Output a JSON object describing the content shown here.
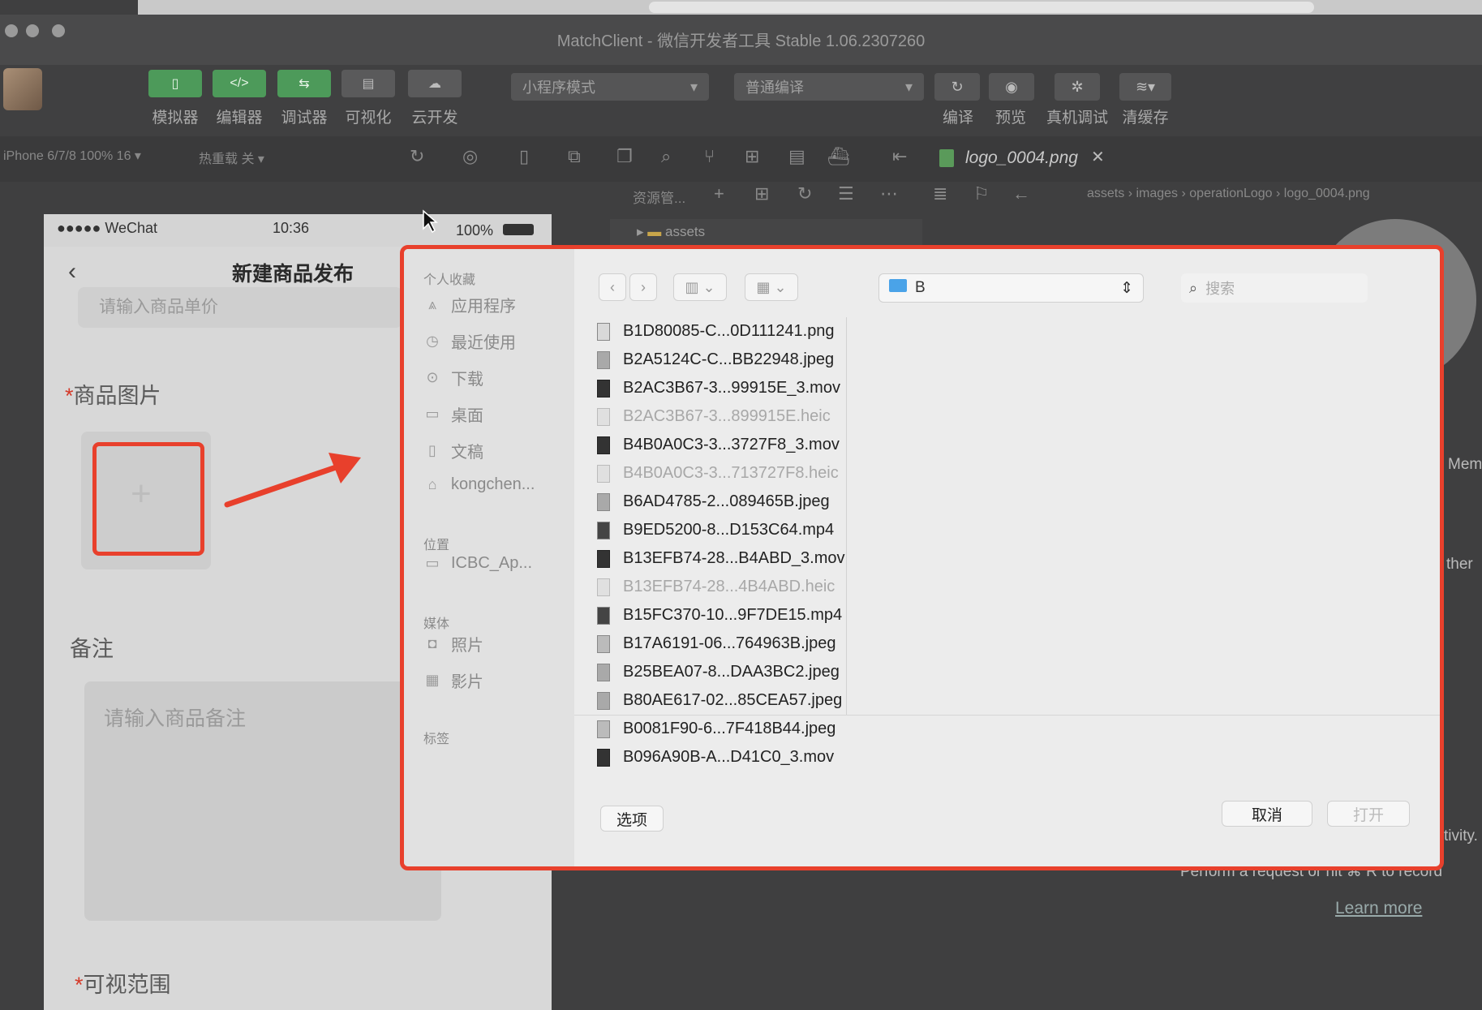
{
  "window": {
    "title": "MatchClient - 微信开发者工具 Stable 1.06.2307260"
  },
  "toolbar": {
    "buttons": [
      {
        "label": "模拟器",
        "icon": "phone-icon"
      },
      {
        "label": "编辑器",
        "icon": "code-icon"
      },
      {
        "label": "调试器",
        "icon": "debug-icon"
      },
      {
        "label": "可视化",
        "icon": "layout-icon"
      },
      {
        "label": "云开发",
        "icon": "cloud-icon"
      }
    ],
    "mode_select": "小程序模式",
    "compile_select": "普通编译",
    "actions": [
      "编译",
      "预览",
      "真机调试",
      "清缓存"
    ]
  },
  "subbar": {
    "device": "iPhone 6/7/8 100% 16 ▾",
    "hotreload": "热重载 关 ▾",
    "explorer_label": "资源管...",
    "tab_file": "logo_0004.png",
    "breadcrumb": [
      "assets",
      "images",
      "operationLogo",
      "logo_0004.png"
    ],
    "tree_folder": "assets"
  },
  "phone": {
    "status": {
      "carrier": "●●●●● WeChat",
      "time": "10:36",
      "battery": "100%"
    },
    "page_title": "新建商品发布",
    "price_placeholder": "请输入商品单价",
    "image_label": "商品图片",
    "remark_label": "备注",
    "remark_placeholder": "请输入商品备注",
    "visibility_label": "可视范围",
    "required_mark": "*",
    "add_symbol": "+"
  },
  "dialog": {
    "sidebar": {
      "favorites_title": "个人收藏",
      "favorites": [
        {
          "label": "应用程序",
          "icon": "apps-icon"
        },
        {
          "label": "最近使用",
          "icon": "clock-icon"
        },
        {
          "label": "下载",
          "icon": "download-icon"
        },
        {
          "label": "桌面",
          "icon": "desktop-icon"
        },
        {
          "label": "文稿",
          "icon": "document-icon"
        },
        {
          "label": "kongchen...",
          "icon": "home-icon"
        }
      ],
      "locations_title": "位置",
      "locations": [
        {
          "label": "ICBC_Ap...",
          "icon": "disk-icon"
        }
      ],
      "media_title": "媒体",
      "media": [
        {
          "label": "照片",
          "icon": "camera-icon"
        },
        {
          "label": "影片",
          "icon": "film-icon"
        }
      ],
      "tags_title": "标签"
    },
    "path_folder": "B",
    "search_placeholder": "搜索",
    "files": [
      {
        "name": "B1D80085-C...0D111241.png",
        "type": "png",
        "dim": false
      },
      {
        "name": "B2A5124C-C...BB22948.jpeg",
        "type": "jpeg",
        "dim": false
      },
      {
        "name": "B2AC3B67-3...99915E_3.mov",
        "type": "mov",
        "dim": false
      },
      {
        "name": "B2AC3B67-3...899915E.heic",
        "type": "heic",
        "dim": true
      },
      {
        "name": "B4B0A0C3-3...3727F8_3.mov",
        "type": "mov",
        "dim": false
      },
      {
        "name": "B4B0A0C3-3...713727F8.heic",
        "type": "heic",
        "dim": true
      },
      {
        "name": "B6AD4785-2...089465B.jpeg",
        "type": "jpeg",
        "dim": false
      },
      {
        "name": "B9ED5200-8...D153C64.mp4",
        "type": "mp4",
        "dim": false
      },
      {
        "name": "B13EFB74-28...B4ABD_3.mov",
        "type": "mov",
        "dim": false
      },
      {
        "name": "B13EFB74-28...4B4ABD.heic",
        "type": "heic",
        "dim": true
      },
      {
        "name": "B15FC370-10...9F7DE15.mp4",
        "type": "mp4",
        "dim": false
      },
      {
        "name": "B17A6191-06...764963B.jpeg",
        "type": "img",
        "dim": false
      },
      {
        "name": "B25BEA07-8...DAA3BC2.jpeg",
        "type": "jpeg",
        "dim": false
      },
      {
        "name": "B80AE617-02...85CEA57.jpeg",
        "type": "jpeg",
        "dim": false
      },
      {
        "name": "B0081F90-6...7F418B44.jpeg",
        "type": "img",
        "dim": false
      },
      {
        "name": "B096A90B-A...D41C0_3.mov",
        "type": "mov",
        "dim": false
      }
    ],
    "options_button": "选项",
    "cancel_button": "取消",
    "open_button": "打开"
  },
  "right_panel": {
    "mem": "Mem",
    "ther": "ther",
    "tivity": "tivity.",
    "perform_text": "Perform a request or hit ⌘ R to record",
    "learn_more": "Learn more"
  },
  "colors": {
    "annotation": "#e8402c",
    "toolbar_green": "#4d9a5a"
  }
}
